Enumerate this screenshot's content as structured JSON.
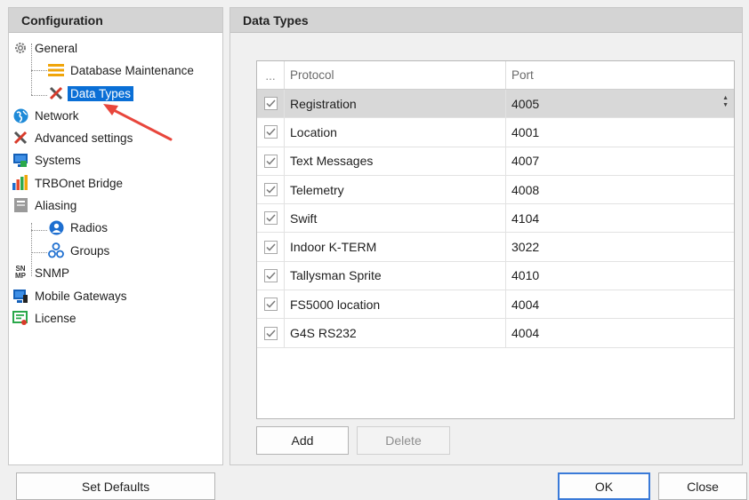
{
  "left": {
    "header": "Configuration",
    "tree": [
      {
        "label": "General",
        "icon": "gear-icon"
      },
      {
        "label": "Database Maintenance",
        "icon": "database-icon"
      },
      {
        "label": "Data Types",
        "icon": "tools-icon",
        "selected": true
      },
      {
        "label": "Network",
        "icon": "globe-icon"
      },
      {
        "label": "Advanced settings",
        "icon": "tools-icon"
      },
      {
        "label": "Systems",
        "icon": "monitor-icon"
      },
      {
        "label": "TRBOnet Bridge",
        "icon": "bars-icon"
      },
      {
        "label": "Aliasing",
        "icon": "aliasing-icon"
      },
      {
        "label": "Radios",
        "icon": "user-icon"
      },
      {
        "label": "Groups",
        "icon": "group-icon"
      },
      {
        "label": "SNMP",
        "icon": "snmp-icon"
      },
      {
        "label": "Mobile Gateways",
        "icon": "mobile-gateway-icon"
      },
      {
        "label": "License",
        "icon": "license-icon"
      }
    ],
    "set_defaults_label": "Set Defaults",
    "icons": {
      "snmp_text_top": "SN",
      "snmp_text_bottom": "MP"
    }
  },
  "right": {
    "header": "Data Types",
    "grid": {
      "columns": [
        "...",
        "Protocol",
        "Port"
      ],
      "rows": [
        {
          "checked": true,
          "protocol": "Registration",
          "port": "4005",
          "selected": true
        },
        {
          "checked": true,
          "protocol": "Location",
          "port": "4001"
        },
        {
          "checked": true,
          "protocol": "Text Messages",
          "port": "4007"
        },
        {
          "checked": true,
          "protocol": "Telemetry",
          "port": "4008"
        },
        {
          "checked": true,
          "protocol": "Swift",
          "port": "4104"
        },
        {
          "checked": true,
          "protocol": "Indoor K-TERM",
          "port": "3022"
        },
        {
          "checked": true,
          "protocol": "Tallysman Sprite",
          "port": "4010"
        },
        {
          "checked": true,
          "protocol": "FS5000 location",
          "port": "4004"
        },
        {
          "checked": true,
          "protocol": "G4S RS232",
          "port": "4004"
        }
      ]
    },
    "add_label": "Add",
    "delete_label": "Delete"
  },
  "footer": {
    "ok_label": "OK",
    "close_label": "Close"
  },
  "colors": {
    "selection": "#0a6fd6",
    "annotation_arrow": "#e8463c",
    "default_button_border": "#3a7ad8"
  }
}
